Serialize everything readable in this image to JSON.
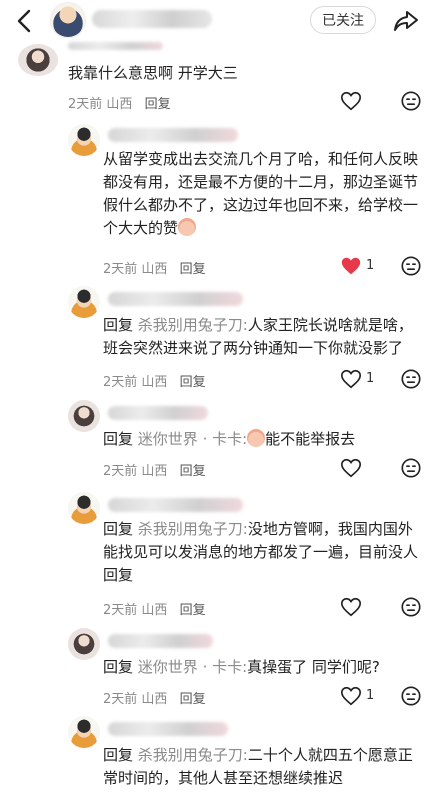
{
  "header": {
    "follow_label": "已关注"
  },
  "comments": [
    {
      "text": "我靠什么意思啊 开学大三",
      "time": "2天前",
      "location": "山西",
      "reply_label": "回复",
      "likes": ""
    },
    {
      "text": "从留学变成出去交流几个月了哈，和任何人反映都没有用，还是最不方便的十二月，那边圣诞节假什么都办不了，这边过年也回不来，给学校一个大大的赞",
      "time": "2天前",
      "location": "山西",
      "reply_label": "回复",
      "likes": "1",
      "liked": true
    },
    {
      "prefix": "回复",
      "reply_to": "杀我别用兔子刀:",
      "text": "人家王院长说啥就是啥，班会突然进来说了两分钟通知一下你就没影了",
      "time": "2天前",
      "location": "山西",
      "reply_label": "回复",
      "likes": "1"
    },
    {
      "prefix": "回复",
      "reply_to": "迷你世界 · 卡卡:",
      "text": "能不能举报去",
      "time": "2天前",
      "location": "山西",
      "reply_label": "回复",
      "likes": ""
    },
    {
      "prefix": "回复",
      "reply_to": "杀我别用兔子刀:",
      "text": "没地方管啊，我国内国外能找见可以发消息的地方都发了一遍，目前没人回复",
      "time": "2天前",
      "location": "山西",
      "reply_label": "回复",
      "likes": ""
    },
    {
      "prefix": "回复",
      "reply_to": "迷你世界 · 卡卡:",
      "text": "真操蛋了 同学们呢?",
      "time": "2天前",
      "location": "山西",
      "reply_label": "回复",
      "likes": "1"
    },
    {
      "prefix": "回复",
      "reply_to": "杀我别用兔子刀:",
      "text": "二十个人就四五个愿意正常时间的，其他人甚至还想继续推迟"
    }
  ],
  "icons": {
    "back": "chevron-left-icon",
    "share": "share-arrow-icon",
    "like": "heart-icon",
    "liked": "heart-filled-icon",
    "dislike": "dislike-face-icon"
  },
  "colors": {
    "liked_heart": "#e8394a",
    "secondary_text": "#8a8a8a"
  }
}
